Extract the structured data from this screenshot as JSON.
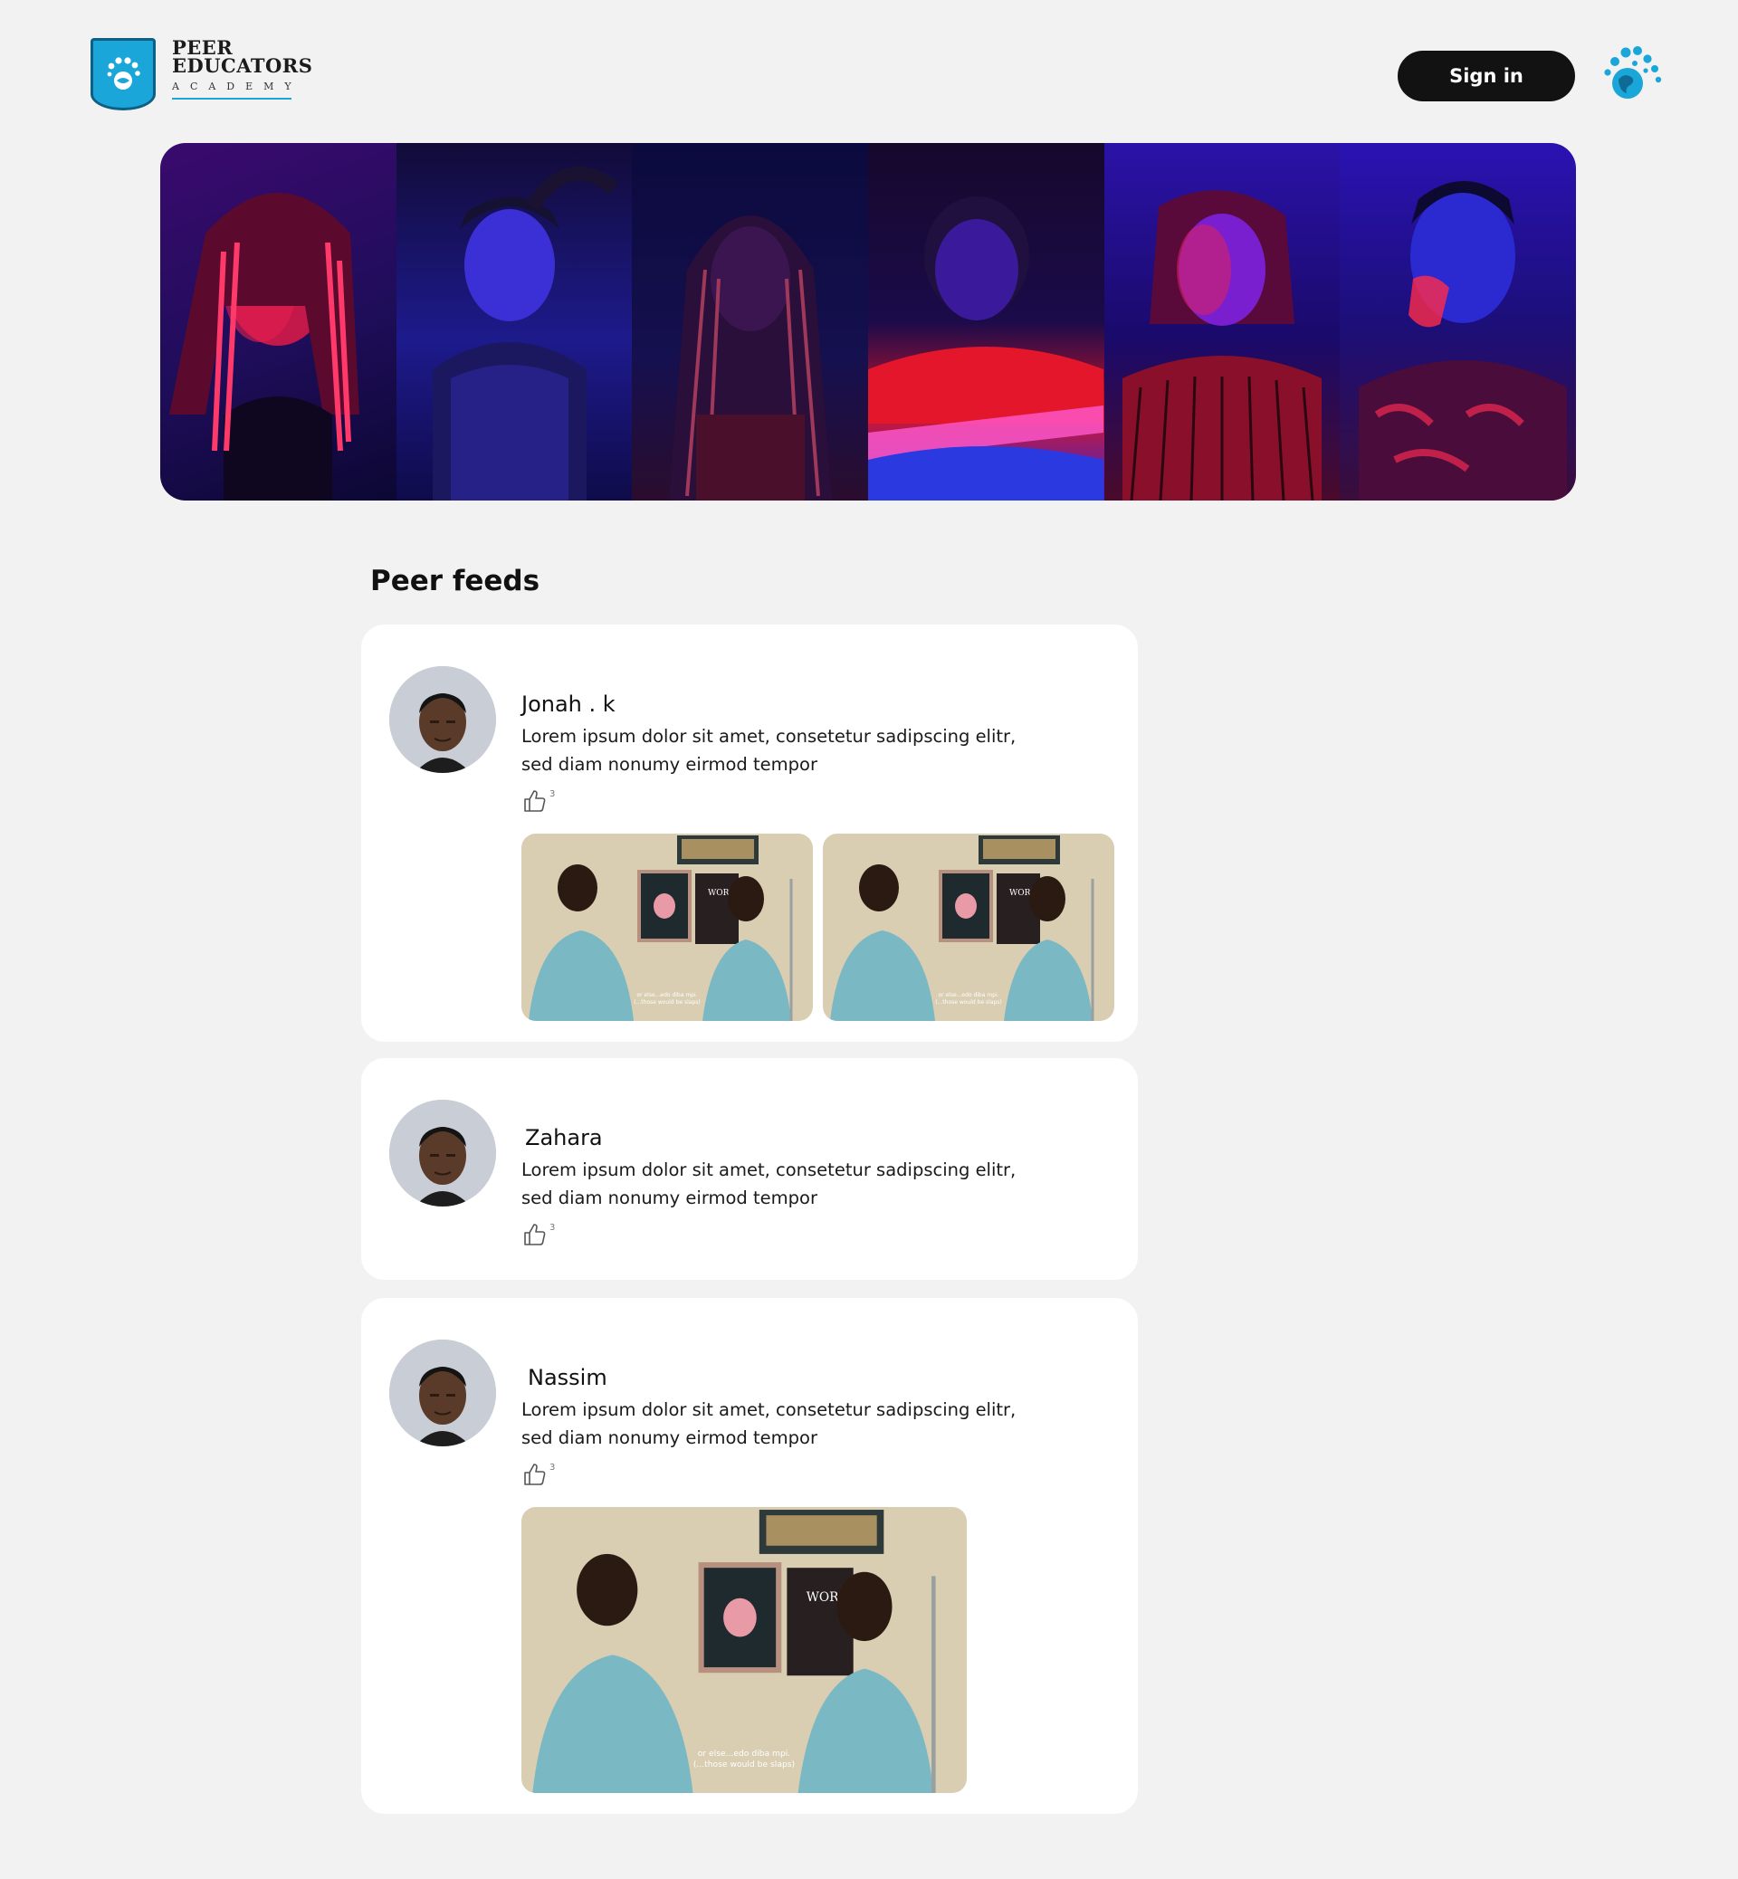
{
  "brand": {
    "line1": "PEER",
    "line2": "EDUCATORS",
    "line3": "ACADEMY",
    "color": "#1aa6d9"
  },
  "header": {
    "signin_label": "Sign in"
  },
  "feed": {
    "title": "Peer feeds",
    "posts": [
      {
        "author": "Jonah . k",
        "text": "Lorem ipsum dolor sit amet, consetetur sadipscing elitr, sed diam nonumy eirmod tempor",
        "likes": "3",
        "photo_count": 2
      },
      {
        "author": "Zahara",
        "text": "Lorem ipsum dolor sit amet, consetetur sadipscing elitr, sed diam nonumy eirmod tempor",
        "likes": "3",
        "photo_count": 0
      },
      {
        "author": "Nassim",
        "text": "Lorem ipsum dolor sit amet, consetetur sadipscing elitr, sed diam nonumy eirmod tempor",
        "likes": "3",
        "photo_count": 1
      }
    ]
  },
  "photo_caption": {
    "line1": "or else...edo diba mpi.",
    "line2": "(...those would be slaps)"
  },
  "colors": {
    "background": "#f2f2f2",
    "card": "#ffffff",
    "button": "#121212",
    "accent": "#1aa6d9"
  },
  "icons": [
    "shield-logo-icon",
    "hand-globe-icon",
    "thumbs-up-icon"
  ]
}
